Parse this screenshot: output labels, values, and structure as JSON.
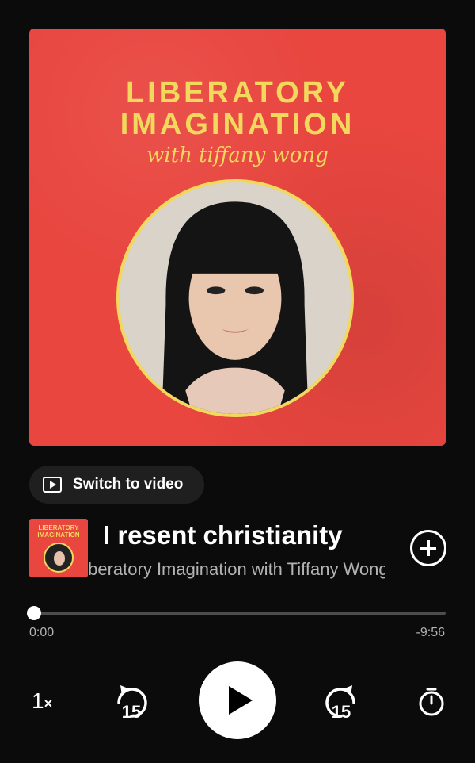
{
  "cover": {
    "title_line1": "LIBERATORY",
    "title_line2": "IMAGINATION",
    "subtitle": "with tiffany wong"
  },
  "switch_video": {
    "label": "Switch to video",
    "icon": "video-play-icon"
  },
  "episode": {
    "title": "I resent christianity",
    "show": "Liberatory Imagination with Tiffany Wong",
    "thumb_title_line1": "LIBERATORY",
    "thumb_title_line2": "IMAGINATION"
  },
  "progress": {
    "elapsed": "0:00",
    "remaining": "-9:56",
    "fraction": 0.0
  },
  "controls": {
    "speed": "1",
    "speed_suffix": "×",
    "skip_back_seconds": "15",
    "skip_forward_seconds": "15",
    "icons": [
      "rewind-15-icon",
      "play-icon",
      "forward-15-icon",
      "sleep-timer-icon",
      "add-icon"
    ]
  },
  "colors": {
    "cover_red": "#e8463f",
    "cover_yellow": "#f2d85c",
    "background": "#0b0b0b"
  }
}
